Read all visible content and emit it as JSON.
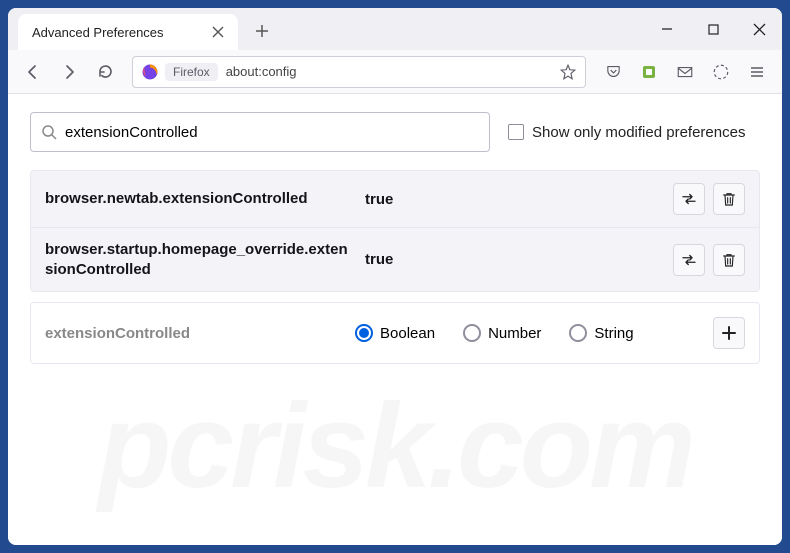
{
  "window": {
    "tab_title": "Advanced Preferences"
  },
  "urlbar": {
    "badge": "Firefox",
    "url": "about:config"
  },
  "search": {
    "value": "extensionControlled",
    "checkbox_label": "Show only modified preferences"
  },
  "prefs": [
    {
      "name": "browser.newtab.extensionControlled",
      "value": "true"
    },
    {
      "name": "browser.startup.homepage_override.extensionControlled",
      "value": "true"
    }
  ],
  "create": {
    "name": "extensionControlled",
    "types": [
      "Boolean",
      "Number",
      "String"
    ],
    "selected": "Boolean"
  },
  "watermark": "pcrisk.com"
}
